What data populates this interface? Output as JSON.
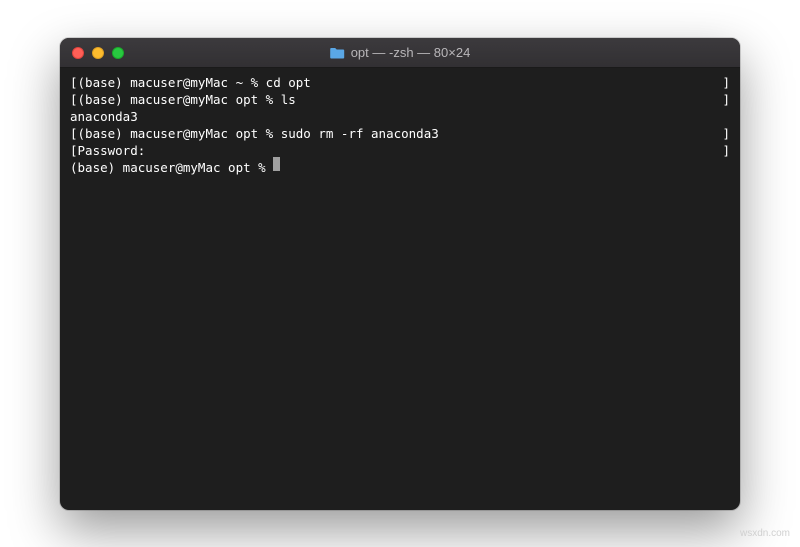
{
  "window": {
    "title": "opt — -zsh — 80×24",
    "icon": "folder-icon"
  },
  "terminal": {
    "lines": [
      {
        "left": "[(base) macuser@myMac ~ % cd opt",
        "right": "]"
      },
      {
        "left": "[(base) macuser@myMac opt % ls",
        "right": "]"
      },
      {
        "left": "anaconda3",
        "right": ""
      },
      {
        "left": "[(base) macuser@myMac opt % sudo rm -rf anaconda3",
        "right": "]"
      },
      {
        "left": "[Password:",
        "right": "]"
      }
    ],
    "prompt": "(base) macuser@myMac opt % "
  },
  "watermark": "wsxdn.com"
}
